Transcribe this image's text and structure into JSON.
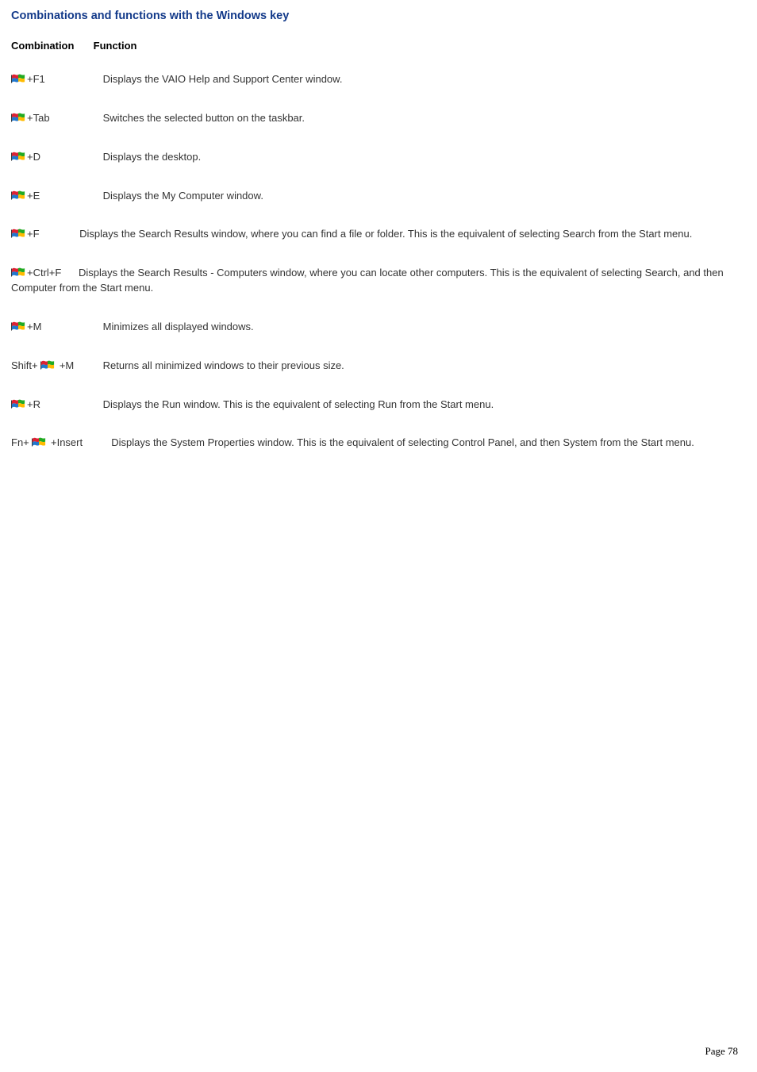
{
  "title": "Combinations and functions with the Windows key",
  "header": {
    "combination": "Combination",
    "function": "Function"
  },
  "rows": {
    "f1": {
      "suffix": "+F1",
      "desc": "Displays the VAIO Help and Support Center window."
    },
    "tab": {
      "suffix": "+Tab",
      "desc": "Switches the selected button on the taskbar."
    },
    "d": {
      "suffix": "+D",
      "desc": "Displays the desktop."
    },
    "e": {
      "suffix": "+E",
      "desc": "Displays the My Computer window."
    },
    "f": {
      "suffix": "+F",
      "desc": "Displays the Search Results window, where you can find a file or folder. This is the equivalent of selecting Search from the Start menu."
    },
    "ctrlf": {
      "suffix": "+Ctrl+F",
      "desc": "Displays the Search Results - Computers window, where you can locate other computers. This is the equivalent of selecting Search, and then Computer from the Start menu."
    },
    "m": {
      "suffix": "+M",
      "desc": "Minimizes all displayed windows."
    },
    "shiftm": {
      "prefix": "Shift+ ",
      "suffix": " +M",
      "desc": "Returns all minimized windows to their previous size."
    },
    "r": {
      "suffix": "+R",
      "desc": "Displays the Run window. This is the equivalent of selecting Run from the Start menu."
    },
    "insert": {
      "prefix": "Fn+ ",
      "suffix": " +Insert",
      "desc": "Displays the System Properties window. This is the equivalent of selecting Control Panel, and then System from the Start menu."
    }
  },
  "footer": "Page 78"
}
